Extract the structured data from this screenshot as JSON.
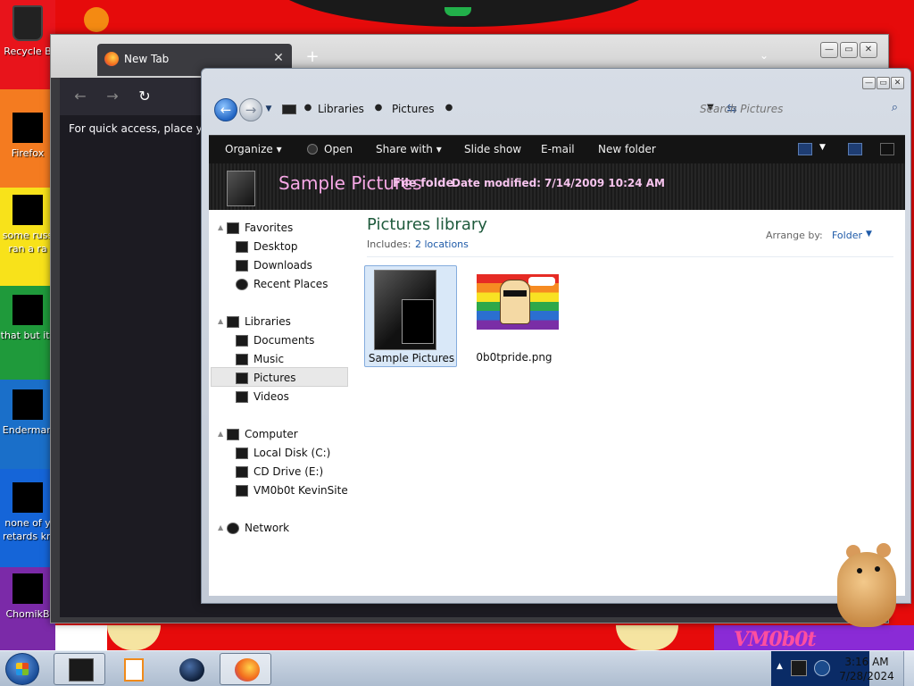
{
  "desktop": {
    "icons": [
      {
        "label": "Recycle B"
      },
      {
        "label": "Firefox"
      },
      {
        "label": "some russ ran a ra"
      },
      {
        "label": "that but its"
      },
      {
        "label": "Enderman"
      },
      {
        "label": "none of y retards kn"
      },
      {
        "label": "ChomikB"
      }
    ],
    "wallpaper_text": "VM0b0t"
  },
  "firefox": {
    "tab_title": "New Tab",
    "tab_close": "✕",
    "new_tab": "+",
    "list_tabs": "⌄",
    "bookmark_hint": "For quick access, place your",
    "window_controls": {
      "minimize": "—",
      "maximize": "▭",
      "close": "✕"
    },
    "nav": {
      "back": "←",
      "forward": "→",
      "reload": "↻"
    }
  },
  "explorer": {
    "window_controls": {
      "minimize": "—",
      "maximize": "▭",
      "close": "✕"
    },
    "breadcrumb": [
      "Libraries",
      "Pictures"
    ],
    "search_placeholder": "Search Pictures",
    "toolbar": {
      "organize": "Organize ▾",
      "open": "Open",
      "share_with": "Share with ▾",
      "slide_show": "Slide show",
      "email": "E-mail",
      "new_folder": "New folder"
    },
    "details": {
      "title": "Sample Pictures",
      "type": "File folde",
      "date_label": "Date modified:",
      "date_value": "7/14/2009 10:24 AM"
    },
    "nav_pane": {
      "favorites": "Favorites",
      "desktop": "Desktop",
      "downloads": "Downloads",
      "recent_places": "Recent Places",
      "libraries": "Libraries",
      "documents": "Documents",
      "music": "Music",
      "pictures": "Pictures",
      "videos": "Videos",
      "computer": "Computer",
      "local_disk": "Local Disk (C:)",
      "cd_drive": "CD Drive (E:)",
      "kevinsite": "VM0b0t KevinSite",
      "network": "Network"
    },
    "content": {
      "library_title": "Pictures library",
      "includes_label": "Includes:",
      "includes_value": "2 locations",
      "arrange_label": "Arrange by:",
      "arrange_value": "Folder",
      "items": [
        {
          "name": "Sample Pictures"
        },
        {
          "name": "0b0tpride.png"
        }
      ]
    }
  },
  "taskbar": {
    "time": "3:16 AM",
    "date": "7/28/2024"
  },
  "colors": {
    "details_title": "#f7a8e6",
    "library_title": "#1e5a3c",
    "link_blue": "#1e5aa8",
    "selection": "#d9e8f8"
  }
}
